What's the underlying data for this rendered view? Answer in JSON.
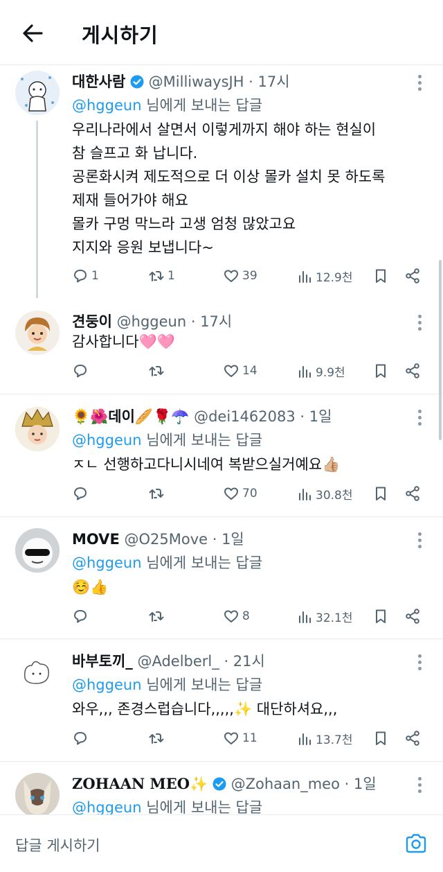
{
  "header": {
    "title": "게시하기"
  },
  "tweets": [
    {
      "name": "대한사람",
      "verified": true,
      "handle": "@MilliwaysJH · 17시",
      "reply_mention": "@hggeun",
      "reply_suffix": " 님에게 보내는 답글",
      "lines": [
        "우리나라에서 살면서 이렇게까지 해야 하는 현실이",
        "참 슬프고 화 납니다.",
        "공론화시켜 제도적으로 더 이상 몰카 설치 못 하도록",
        "제재 들어가야 해요",
        "몰카 구멍 막느라 고생 엄청 많았고요",
        "지지와 응원 보냅니다~"
      ],
      "replies": "1",
      "retweets": "1",
      "likes": "39",
      "views": "12.9천"
    },
    {
      "name": "견둥이",
      "handle": "@hggeun · 17시",
      "lines": [
        "감사합니다🩷🩷"
      ],
      "replies": "",
      "retweets": "",
      "likes": "14",
      "views": "9.9천"
    },
    {
      "name": "🌻🌺데이🥖🌹☂️",
      "handle": "@dei1462083 · 1일",
      "reply_mention": "@hggeun",
      "reply_suffix": " 님에게 보내는 답글",
      "lines": [
        "ㅈㄴ 선행하고다니시네여 복받으실거예요👍🏼"
      ],
      "replies": "",
      "retweets": "",
      "likes": "70",
      "views": "30.8천"
    },
    {
      "name": "MOVE",
      "handle": "@O25Move · 1일",
      "reply_mention": "@hggeun",
      "reply_suffix": " 님에게 보내는 답글",
      "lines": [
        "☺️👍"
      ],
      "replies": "",
      "retweets": "",
      "likes": "8",
      "views": "32.1천"
    },
    {
      "name": "바부토끼_",
      "handle": "@Adelberl_ · 21시",
      "reply_mention": "@hggeun",
      "reply_suffix": " 님에게 보내는 답글",
      "lines": [
        "와우,,, 존경스럽습니다,,,,,✨ 대단하셔요,,,"
      ],
      "replies": "",
      "retweets": "",
      "likes": "11",
      "views": "13.7천"
    },
    {
      "name": "Z𝐎𝐇𝐀𝐀𝐍 𝐌𝐄𝐎✨",
      "verified": true,
      "handle": "@Zohaan_meo · 1일",
      "reply_mention": "@hggeun",
      "reply_suffix": " 님에게 보내는 답글"
    }
  ],
  "composer": {
    "placeholder": "답글 게시하기"
  },
  "icons": {
    "back": "arrow-left-icon",
    "more": "more-vertical-icon",
    "reply": "speech-bubble-icon",
    "retweet": "retweet-icon",
    "like": "heart-icon",
    "views": "bar-chart-icon",
    "bookmark": "bookmark-icon",
    "share": "share-icon",
    "camera": "camera-icon",
    "verified": "verified-badge-icon"
  },
  "colors": {
    "accent": "#1d9bf0",
    "text": "#0f1419",
    "muted": "#536471",
    "divider": "#e6ecf0"
  }
}
